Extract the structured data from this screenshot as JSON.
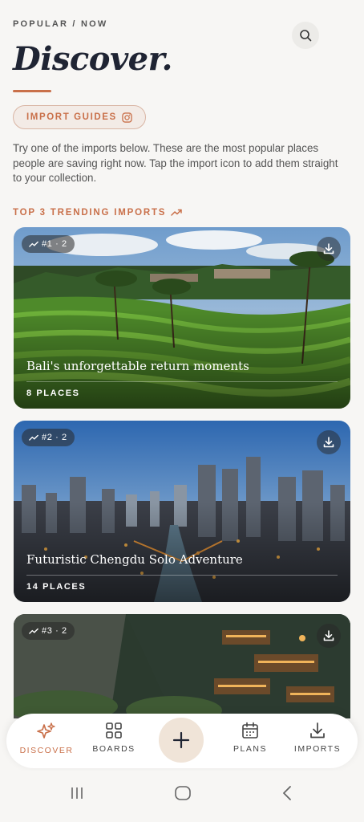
{
  "header": {
    "eyebrow": "POPULAR / NOW",
    "title": "Discover."
  },
  "import_button": {
    "label": "IMPORT GUIDES",
    "icon": "instagram-icon"
  },
  "description": "Try one of the imports below. These are the most popular places people are saving right now. Tap the import icon to add them straight to your collection.",
  "trending": {
    "heading": "TOP 3 TRENDING IMPORTS",
    "cards": [
      {
        "rank": "#1 · 2",
        "title": "Bali's unforgettable return moments",
        "count": "8 PLACES"
      },
      {
        "rank": "#2 · 2",
        "title": "Futuristic Chengdu Solo Adventure",
        "count": "14 PLACES"
      },
      {
        "rank": "#3 · 2"
      }
    ]
  },
  "tabbar": {
    "discover": "DISCOVER",
    "boards": "BOARDS",
    "plans": "PLANS",
    "imports": "IMPORTS"
  },
  "colors": {
    "accent": "#c9704a",
    "ink": "#1f2433",
    "background": "#f7f6f4"
  }
}
